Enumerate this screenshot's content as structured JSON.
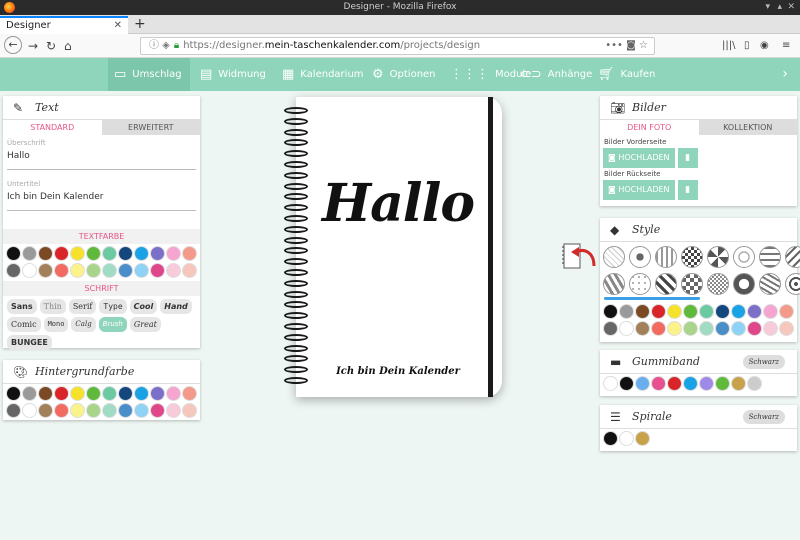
{
  "window": {
    "title": "Designer - Mozilla Firefox"
  },
  "browser": {
    "tab_label": "Designer",
    "url_prefix": "https://designer.",
    "url_domain": "mein-taschenkalender.com",
    "url_path": "/projects/design"
  },
  "menu": [
    {
      "label": "Umschlag",
      "icon": "book-icon",
      "active": true
    },
    {
      "label": "Widmung",
      "icon": "message-icon",
      "active": false
    },
    {
      "label": "Kalendarium",
      "icon": "calendar-icon",
      "active": false
    },
    {
      "label": "Optionen",
      "icon": "gear-icon",
      "active": false
    },
    {
      "label": "Module",
      "icon": "modules-icon",
      "active": false
    },
    {
      "label": "Anhänge",
      "icon": "paperclip-icon",
      "active": false
    },
    {
      "label": "Kaufen",
      "icon": "cart-icon",
      "active": false
    }
  ],
  "text_panel": {
    "title": "Text",
    "tab_standard": "STANDARD",
    "tab_advanced": "ERWEITERT",
    "heading_label": "Überschrift",
    "heading_value": "Hallo",
    "subtitle_label": "Untertitel",
    "subtitle_value": "Ich bin Dein Kalender",
    "textcolor_label": "TEXTFARBE",
    "font_label": "SCHRIFT",
    "fonts": [
      "Sans",
      "Thin",
      "Serif",
      "Type",
      "Cool",
      "Hand",
      "Comic",
      "Mono",
      "Calg",
      "Brush",
      "Great",
      "BUNGEE"
    ],
    "selected_font": "Brush"
  },
  "bg_panel": {
    "title": "Hintergrundfarbe"
  },
  "palette": [
    "#111111",
    "#9a9a9a",
    "#7b4a24",
    "#d9252a",
    "#f6e22b",
    "#5fb93a",
    "#6ccaa3",
    "#15477f",
    "#19a3e6",
    "#7b6fc7",
    "#f5a5cf",
    "#f39a8a",
    "#666666",
    "#ffffff",
    "#a2805a",
    "#f26a60",
    "#fbf28a",
    "#a8d58a",
    "#9fdcc3",
    "#4a8ec9",
    "#8ed2f5",
    "#e0468a",
    "#f8cbdb",
    "#f6c7bd"
  ],
  "cover": {
    "heading": "Hallo",
    "subtitle": "Ich bin Dein Kalender",
    "rings": 26
  },
  "bilder_panel": {
    "title": "Bilder",
    "tab_photo": "DEIN FOTO",
    "tab_collection": "KOLLEKTION",
    "front_label": "Bilder Vorderseite",
    "back_label": "Bilder Rückseite",
    "upload_label": "HOCHLADEN"
  },
  "style_panel": {
    "title": "Style",
    "palette": [
      "#111111",
      "#9a9a9a",
      "#7b4a24",
      "#d9252a",
      "#f6e22b",
      "#5fb93a",
      "#6ccaa3",
      "#15477f",
      "#19a3e6",
      "#7b6fc7",
      "#f5a5cf",
      "#f39a8a",
      "#666666",
      "#ffffff",
      "#a2805a",
      "#f26a60",
      "#fbf28a",
      "#a8d58a",
      "#9fdcc3",
      "#4a8ec9",
      "#8ed2f5",
      "#e0468a",
      "#f8cbdb",
      "#f6c7bd"
    ]
  },
  "band_panel": {
    "title": "Gummiband",
    "button": "Schwarz",
    "colors": [
      "#ffffff",
      "#111111",
      "#6aaef0",
      "#e8508f",
      "#d9252a",
      "#19a3e6",
      "#a08ae8",
      "#5fb93a",
      "#c8a24a",
      "#cccccc"
    ]
  },
  "spiral_panel": {
    "title": "Spirale",
    "button": "Schwarz",
    "colors": [
      "#111111",
      "#ffffff",
      "#c8a24a"
    ]
  },
  "accent": "#8fd5bc",
  "highlight": "#e6558a"
}
